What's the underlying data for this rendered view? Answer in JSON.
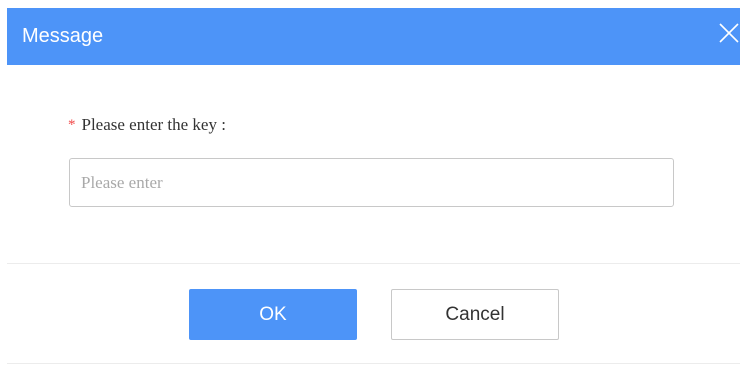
{
  "dialog": {
    "title": "Message",
    "close_icon": "close-icon",
    "accent_color": "#4d94f8"
  },
  "form": {
    "required_mark": "*",
    "key_label": "Please enter the key :",
    "key_value": "",
    "key_placeholder": "Please enter"
  },
  "footer": {
    "ok_label": "OK",
    "cancel_label": "Cancel"
  }
}
